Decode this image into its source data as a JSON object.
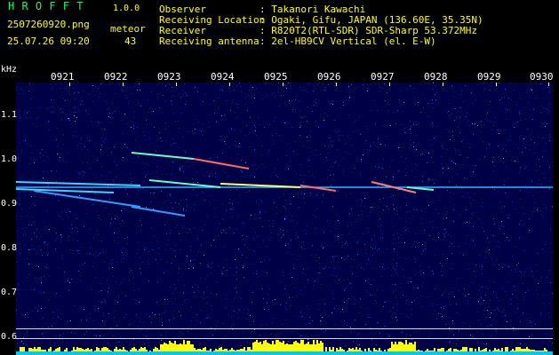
{
  "app": {
    "title": "H R O F F T",
    "version": "1.0.0",
    "file_name": "2507260920.png",
    "datetime": "25.07.26 09:20",
    "meteor_label": "meteor",
    "meteor_count": "43"
  },
  "info": [
    {
      "label": "Observer",
      "value": ": Takanori Kawachi"
    },
    {
      "label": "Receiving Location",
      "value": ": Ogaki, Gifu, JAPAN (136.60E, 35.35N)"
    },
    {
      "label": "Receiver",
      "value": ": R820T2(RTL-SDR) SDR-Sharp 53.372MHz"
    },
    {
      "label": "Receiving antenna",
      "value": ": 2el-HB9CV Vertical (el. E-W)"
    }
  ],
  "axis": {
    "unit": "kHz",
    "freq_labels": [
      "1.1",
      "1.0",
      "0.9",
      "0.8",
      "0.7",
      "0.6"
    ],
    "time_labels": [
      "0921",
      "0922",
      "0923",
      "0924",
      "0925",
      "0926",
      "0927",
      "0928",
      "0929",
      "0930"
    ]
  },
  "colors": {
    "title": "#00ff66",
    "label": "#ffff00",
    "background": "#000046",
    "signal": "#00ffff",
    "level": "#ffff00"
  }
}
